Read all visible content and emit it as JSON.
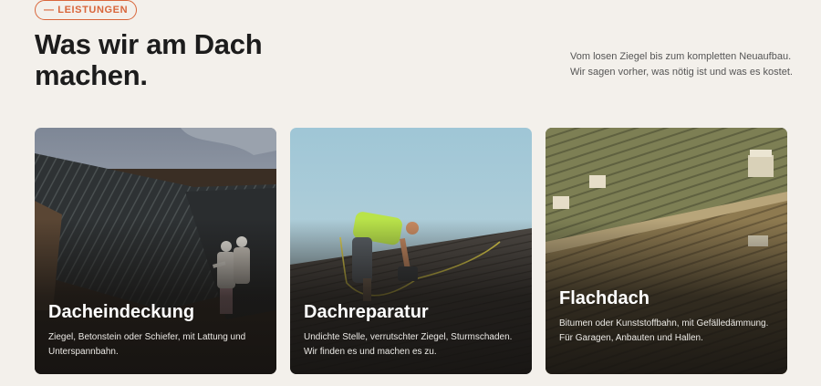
{
  "section": {
    "badge": "— LEISTUNGEN",
    "title": "Was wir am Dach machen.",
    "intro": "Vom losen Ziegel bis zum kompletten Neuaufbau. Wir sagen vorher, was nötig ist und was es kostet."
  },
  "cards": [
    {
      "title": "Dacheindeckung",
      "text": "Ziegel, Betonstein oder Schiefer, mit Lattung und Unterspannbahn.",
      "image": "metal-roof-workers-photo"
    },
    {
      "title": "Dachreparatur",
      "text": "Undichte Stelle, verrutschter Ziegel, Sturmschaden. Wir finden es und machen es zu.",
      "image": "roofer-repair-photo"
    },
    {
      "title": "Flachdach",
      "text": "Bitumen oder Kunststoffbahn, mit Gefälledämmung. Für Garagen, Anbauten und Hallen.",
      "image": "flat-roof-photo"
    }
  ],
  "colors": {
    "accent": "#d9663b",
    "background": "#f3f0eb",
    "heading": "#1c1c1c"
  }
}
